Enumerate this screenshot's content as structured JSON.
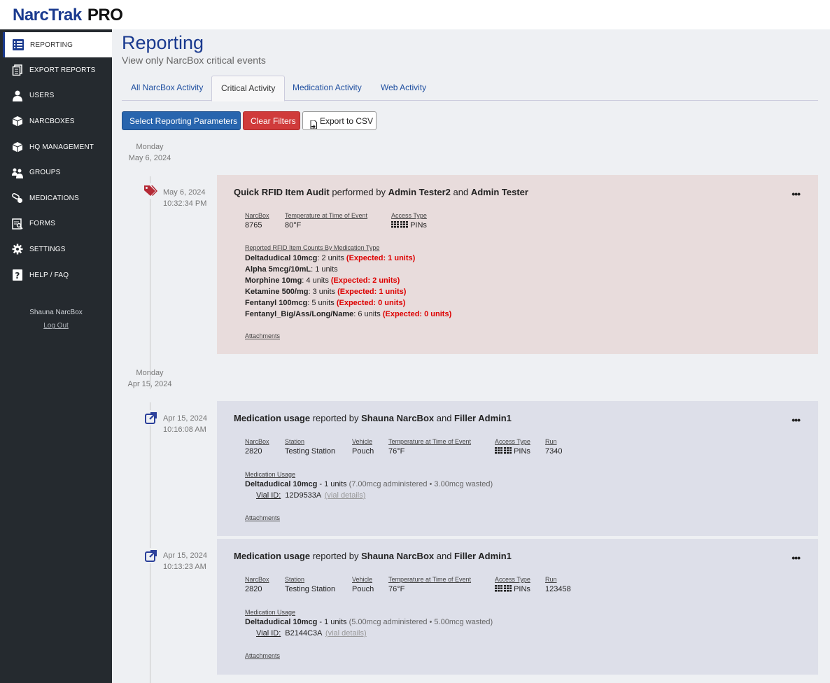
{
  "app": {
    "logo_narc": "NarcTrak",
    "logo_pro": "PRO"
  },
  "sidebar": {
    "items": [
      {
        "label": "REPORTING",
        "icon": "list-icon"
      },
      {
        "label": "EXPORT REPORTS",
        "icon": "documents-icon"
      },
      {
        "label": "USERS",
        "icon": "user-icon"
      },
      {
        "label": "NARCBOXES",
        "icon": "box-icon"
      },
      {
        "label": "HQ MANAGEMENT",
        "icon": "box-icon"
      },
      {
        "label": "GROUPS",
        "icon": "group-icon"
      },
      {
        "label": "MEDICATIONS",
        "icon": "pills-icon"
      },
      {
        "label": "FORMS",
        "icon": "form-search-icon"
      },
      {
        "label": "SETTINGS",
        "icon": "gear-icon"
      },
      {
        "label": "HELP / FAQ",
        "icon": "question-icon"
      }
    ],
    "user_name": "Shauna NarcBox",
    "logout": "Log Out"
  },
  "page": {
    "title": "Reporting",
    "subtitle": "View only NarcBox critical events"
  },
  "tabs": [
    "All NarcBox Activity",
    "Critical Activity",
    "Medication Activity",
    "Web Activity"
  ],
  "buttons": {
    "select_params": "Select Reporting Parameters",
    "clear_filters": "Clear Filters",
    "export_csv": "Export to CSV"
  },
  "timeline": {
    "day1": {
      "weekday": "Monday",
      "date": "May 6, 2024"
    },
    "day2": {
      "weekday": "Monday",
      "date": "Apr 15, 2024"
    },
    "event1": {
      "date": "May 6, 2024",
      "time": "10:32:34 PM",
      "title_action": "Quick RFID Item Audit",
      "title_mid": " performed by ",
      "user1": "Admin Tester2",
      "title_and": " and ",
      "user2": "Admin Tester",
      "fields": [
        {
          "label": "NarcBox",
          "value": "8765"
        },
        {
          "label": "Temperature at Time of Event",
          "value": "80°F"
        },
        {
          "label": "Access Type",
          "value": "PINs"
        }
      ],
      "rfid_label": "Reported RFID Item Counts By Medication Type",
      "rfid": [
        {
          "name": "Deltadudical 10mcg",
          "count": ": 2 units ",
          "expected": "(Expected: 1 units)"
        },
        {
          "name": "Alpha 5mcg/10mL",
          "count": ": 1 units",
          "expected": ""
        },
        {
          "name": "Morphine 10mg",
          "count": ": 4 units ",
          "expected": "(Expected: 2 units)"
        },
        {
          "name": "Ketamine 500/mg",
          "count": ": 3 units ",
          "expected": "(Expected: 1 units)"
        },
        {
          "name": "Fentanyl 100mcg",
          "count": ": 5 units ",
          "expected": "(Expected: 0 units)"
        },
        {
          "name": "Fentanyl_Big/Ass/Long/Name",
          "count": ": 6 units ",
          "expected": "(Expected: 0 units)"
        }
      ],
      "attachments": "Attachments"
    },
    "event2": {
      "date": "Apr 15, 2024",
      "time": "10:16:08 AM",
      "title_action": "Medication usage",
      "title_mid": " reported by ",
      "user1": "Shauna NarcBox",
      "title_and": " and ",
      "user2": "Filler Admin1",
      "fields": [
        {
          "label": "NarcBox",
          "value": "2820"
        },
        {
          "label": "Station",
          "value": "Testing Station"
        },
        {
          "label": "Vehicle",
          "value": "Pouch"
        },
        {
          "label": "Temperature at Time of Event",
          "value": "76°F"
        },
        {
          "label": "Access Type",
          "value": "PINs"
        },
        {
          "label": "Run",
          "value": "7340"
        }
      ],
      "usage_label": "Medication Usage",
      "med_name": "Deltadudical 10mcg",
      "med_units": " - 1 units ",
      "med_note": "(7.00mcg administered • 3.00mcg wasted)",
      "vial_label": "Vial ID:",
      "vial_id": "12D9533A",
      "vial_details": "(vial details)",
      "attachments": "Attachments"
    },
    "event3": {
      "date": "Apr 15, 2024",
      "time": "10:13:23 AM",
      "title_action": "Medication usage",
      "title_mid": " reported by ",
      "user1": "Shauna NarcBox",
      "title_and": " and ",
      "user2": "Filler Admin1",
      "fields": [
        {
          "label": "NarcBox",
          "value": "2820"
        },
        {
          "label": "Station",
          "value": "Testing Station"
        },
        {
          "label": "Vehicle",
          "value": "Pouch"
        },
        {
          "label": "Temperature at Time of Event",
          "value": "76°F"
        },
        {
          "label": "Access Type",
          "value": "PINs"
        },
        {
          "label": "Run",
          "value": "123458"
        }
      ],
      "usage_label": "Medication Usage",
      "med_name": "Deltadudical 10mcg",
      "med_units": " - 1 units ",
      "med_note": "(5.00mcg administered • 5.00mcg wasted)",
      "vial_label": "Vial ID:",
      "vial_id": "B2144C3A",
      "vial_details": "(vial details)",
      "attachments": "Attachments"
    }
  },
  "colors": {
    "brand": "#1a3a8f",
    "sidebar": "#252a2f",
    "critical_card": "#e8dcdc",
    "usage_card": "#dddfe9",
    "expected_red": "#dd0000",
    "primary_button": "#2865ae",
    "danger_button": "#d03b3b"
  }
}
